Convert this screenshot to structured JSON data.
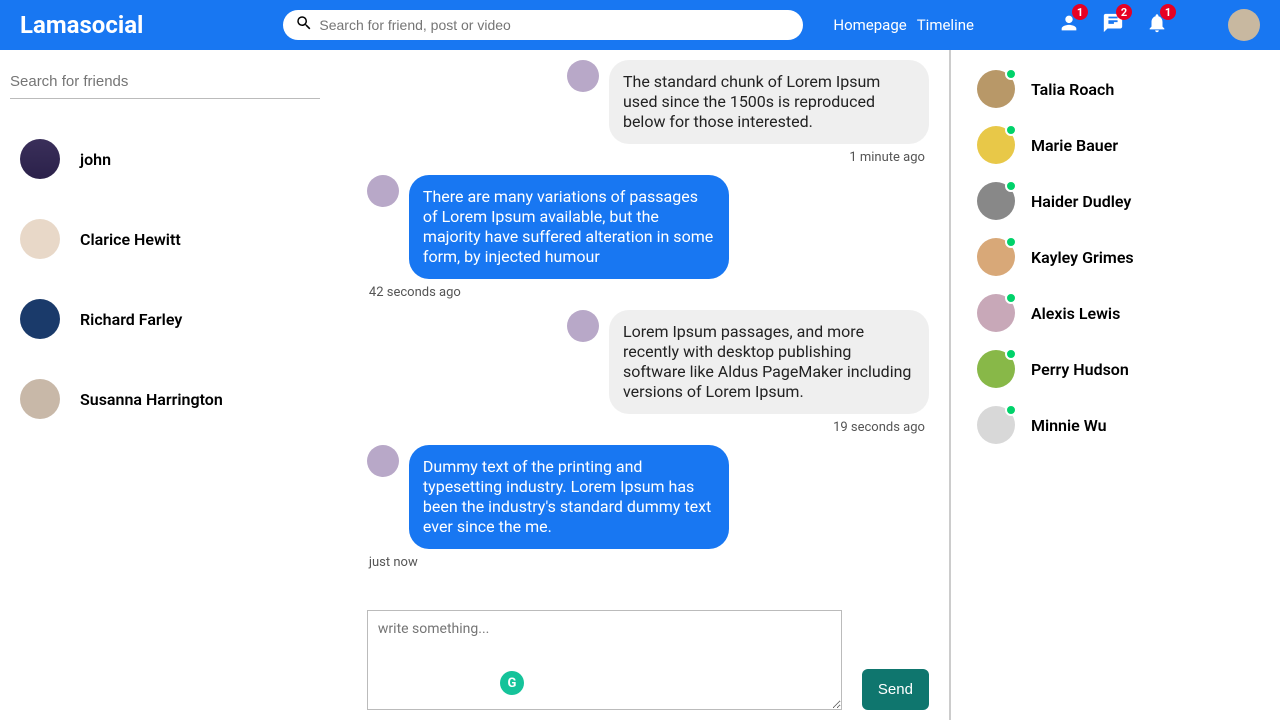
{
  "topbar": {
    "logo": "Lamasocial",
    "search_placeholder": "Search for friend, post or video",
    "nav": {
      "home": "Homepage",
      "timeline": "Timeline"
    },
    "badges": {
      "person": "1",
      "chat": "2",
      "bell": "1"
    }
  },
  "left": {
    "search_placeholder": "Search for friends",
    "friends": [
      {
        "name": "john"
      },
      {
        "name": "Clarice Hewitt"
      },
      {
        "name": "Richard Farley"
      },
      {
        "name": "Susanna Harrington"
      }
    ]
  },
  "chat": {
    "messages": [
      {
        "side": "right",
        "color": "gray",
        "text": "The standard chunk of Lorem Ipsum used since the 1500s is reproduced below for those interested.",
        "time": "1 minute ago"
      },
      {
        "side": "left",
        "color": "blue",
        "text": "There are many variations of passages of Lorem Ipsum available, but the majority have suffered alteration in some form, by injected humour",
        "time": "42 seconds ago"
      },
      {
        "side": "right",
        "color": "gray",
        "text": "Lorem Ipsum passages, and more recently with desktop publishing software like Aldus PageMaker including versions of Lorem Ipsum.",
        "time": "19 seconds ago"
      },
      {
        "side": "left",
        "color": "blue",
        "text": "Dummy text of the printing and typesetting industry. Lorem Ipsum has been the industry's standard dummy text ever since the me.",
        "time": "just now"
      }
    ],
    "compose_placeholder": "write something...",
    "send_label": "Send"
  },
  "online": [
    {
      "name": "Talia Roach"
    },
    {
      "name": "Marie Bauer"
    },
    {
      "name": "Haider Dudley"
    },
    {
      "name": "Kayley Grimes"
    },
    {
      "name": "Alexis Lewis"
    },
    {
      "name": "Perry Hudson"
    },
    {
      "name": "Minnie Wu"
    }
  ]
}
